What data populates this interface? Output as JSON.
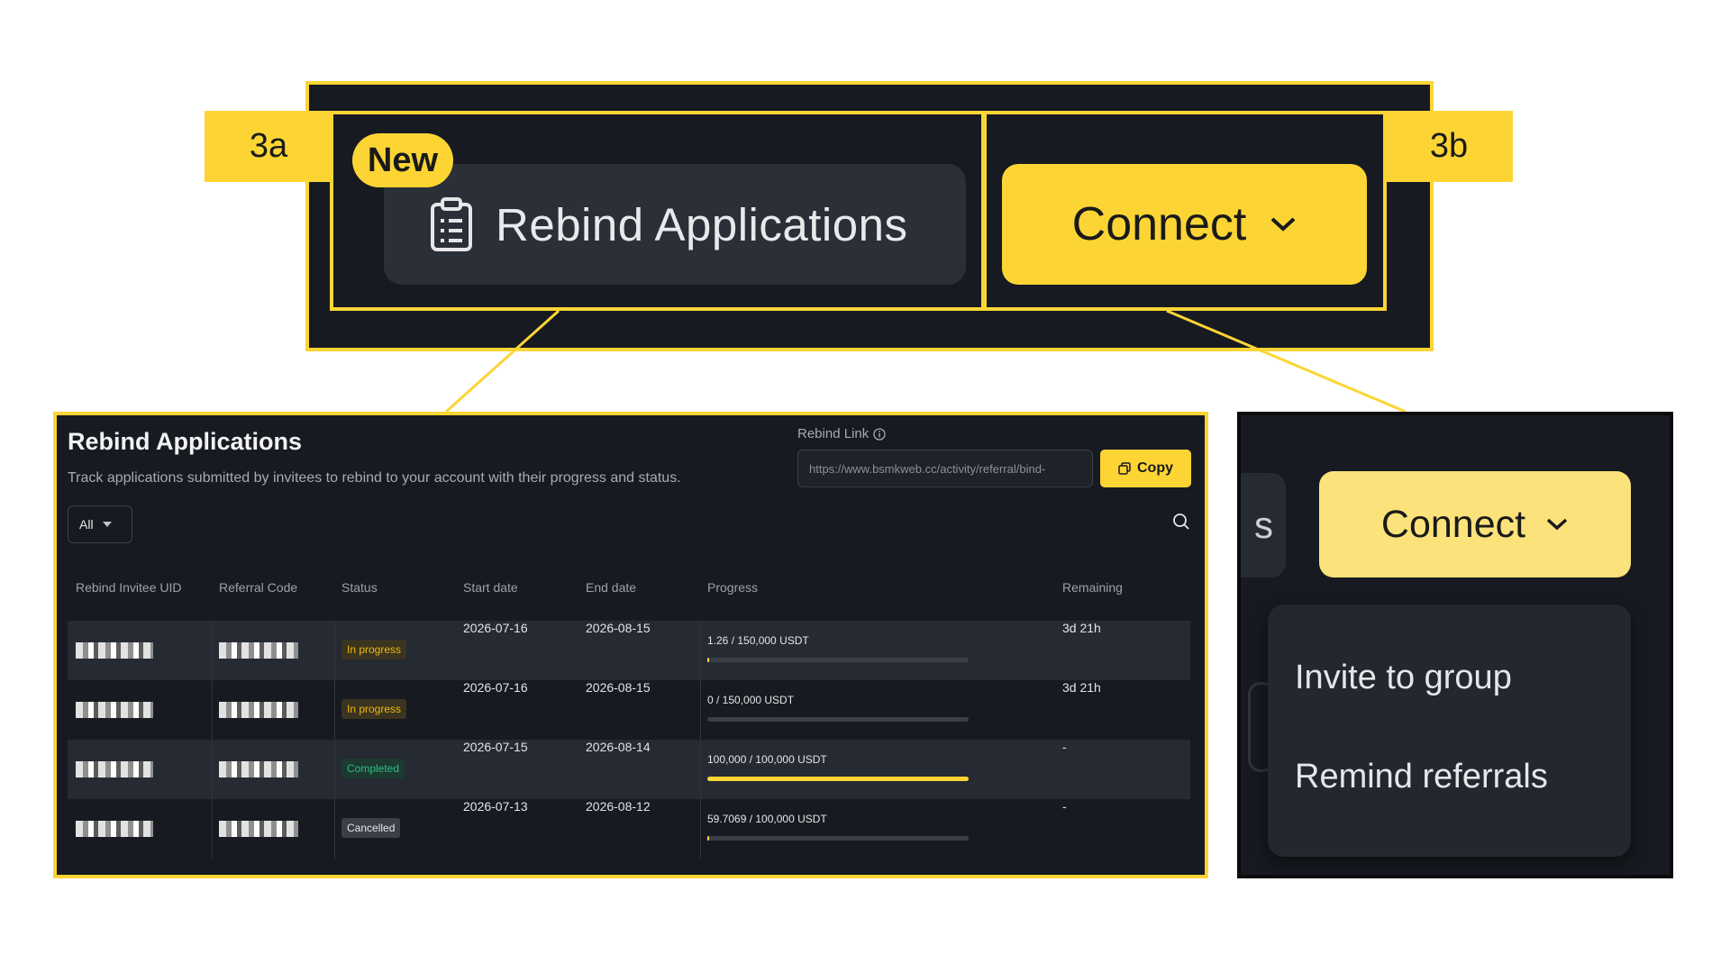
{
  "callouts": {
    "tag_a": "3a",
    "tag_b": "3b"
  },
  "zoom": {
    "new_badge": "New",
    "rebind_button": "Rebind Applications",
    "connect_button": "Connect"
  },
  "rebind_panel": {
    "title": "Rebind Applications",
    "description": "Track applications submitted by invitees to rebind to your account with their progress and status.",
    "filter_value": "All",
    "link_label": "Rebind Link",
    "link_value": "https://www.bsmkweb.cc/activity/referral/bind-",
    "copy_label": "Copy",
    "columns": [
      "Rebind Invitee UID",
      "Referral Code",
      "Status",
      "Start date",
      "End date",
      "Progress",
      "Remaining"
    ],
    "rows": [
      {
        "status": "In progress",
        "start": "2026-07-16",
        "end": "2026-08-15",
        "progress_text": "1.26 / 150,000 USDT",
        "progress": 1e-05,
        "remaining": "3d 21h"
      },
      {
        "status": "In progress",
        "start": "2026-07-16",
        "end": "2026-08-15",
        "progress_text": "0 / 150,000 USDT",
        "progress": 0,
        "remaining": "3d 21h"
      },
      {
        "status": "Completed",
        "start": "2026-07-15",
        "end": "2026-08-14",
        "progress_text": "100,000 / 100,000 USDT",
        "progress": 1,
        "remaining": "-"
      },
      {
        "status": "Cancelled",
        "start": "2026-07-13",
        "end": "2026-08-12",
        "progress_text": "59.7069 / 100,000 USDT",
        "progress": 0.0006,
        "remaining": "-"
      }
    ]
  },
  "connect_panel": {
    "ghost_text": "s",
    "connect_button": "Connect",
    "menu_items": [
      "Invite to group",
      "Remind referrals"
    ]
  },
  "colors": {
    "accent": "#fcd535",
    "background": "#171a21",
    "in_progress": "#f0b90b",
    "completed": "#2ebd85"
  }
}
